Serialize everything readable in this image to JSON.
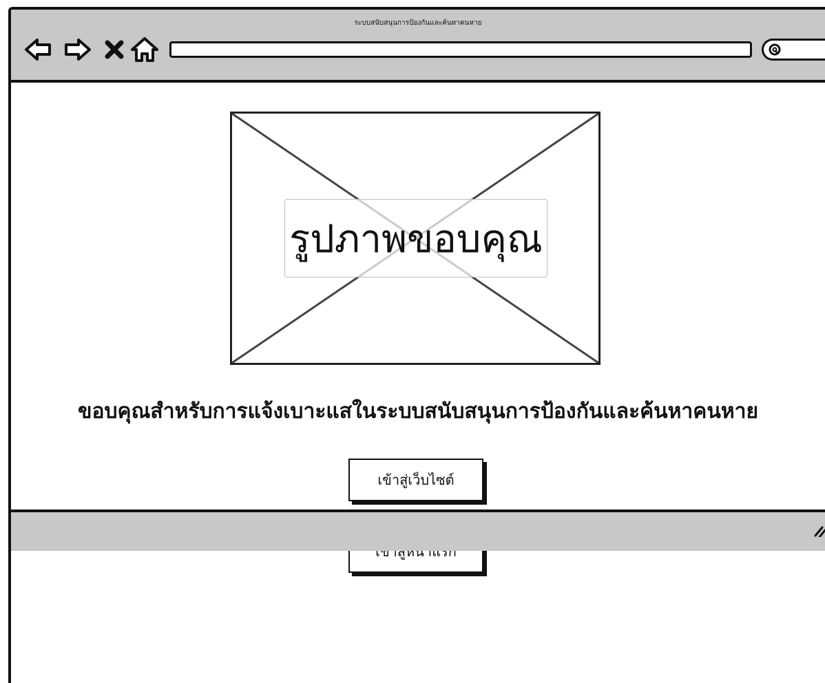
{
  "window": {
    "title": "ระบบสนับสนุนการป้องกันและค้นหาคนหาย"
  },
  "toolbar": {
    "icons": [
      "back-arrow-icon",
      "forward-arrow-icon",
      "close-icon",
      "home-icon",
      "search-icon"
    ],
    "url": ""
  },
  "main": {
    "image_caption": "รูปภาพขอบคุณ",
    "message": "ขอบคุณสำหรับการแจ้งเบาะแสในระบบสนับสนุนการป้องกันและค้นหาคนหาย",
    "buttons": {
      "website_label": "เข้าสู่เว็บไซต์",
      "home_label": "เข้าสู่หน้าแรก"
    }
  },
  "colors": {
    "chrome": "#c8c8c8",
    "border": "#111111",
    "background": "#ffffff"
  }
}
